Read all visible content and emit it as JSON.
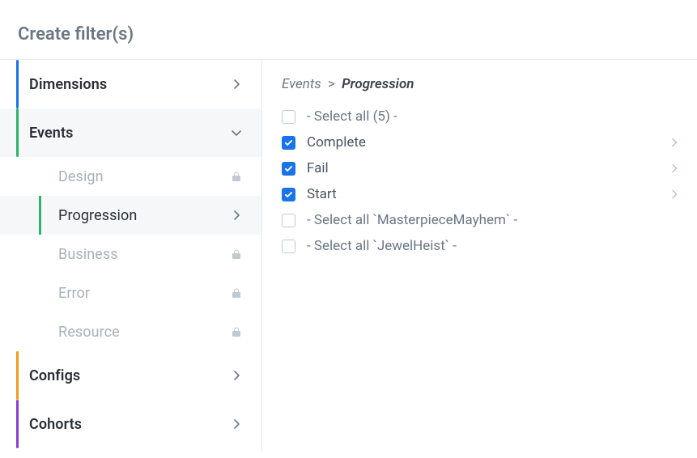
{
  "title": "Create filter(s)",
  "sidebar": {
    "dimensions": {
      "label": "Dimensions",
      "accent": "#1a73e8"
    },
    "events": {
      "label": "Events",
      "accent": "#2db36a",
      "children": {
        "design": {
          "label": "Design",
          "locked": true,
          "active": false
        },
        "progression": {
          "label": "Progression",
          "locked": false,
          "active": true
        },
        "business": {
          "label": "Business",
          "locked": true,
          "active": false
        },
        "error": {
          "label": "Error",
          "locked": true,
          "active": false
        },
        "resource": {
          "label": "Resource",
          "locked": true,
          "active": false
        }
      }
    },
    "configs": {
      "label": "Configs",
      "accent": "#f29b1d"
    },
    "cohorts": {
      "label": "Cohorts",
      "accent": "#8a3fd1"
    }
  },
  "breadcrumb": {
    "root": "Events",
    "sep": ">",
    "current": "Progression"
  },
  "options": {
    "select_all": {
      "label": "- Select all (5) -",
      "checked": false,
      "expandable": false
    },
    "complete": {
      "label": "Complete",
      "checked": true,
      "expandable": true
    },
    "fail": {
      "label": "Fail",
      "checked": true,
      "expandable": true
    },
    "start": {
      "label": "Start",
      "checked": true,
      "expandable": true
    },
    "grp_master": {
      "label": "- Select all `MasterpieceMayhem` -",
      "checked": false,
      "expandable": false
    },
    "grp_jewel": {
      "label": "- Select all `JewelHeist` -",
      "checked": false,
      "expandable": false
    }
  }
}
